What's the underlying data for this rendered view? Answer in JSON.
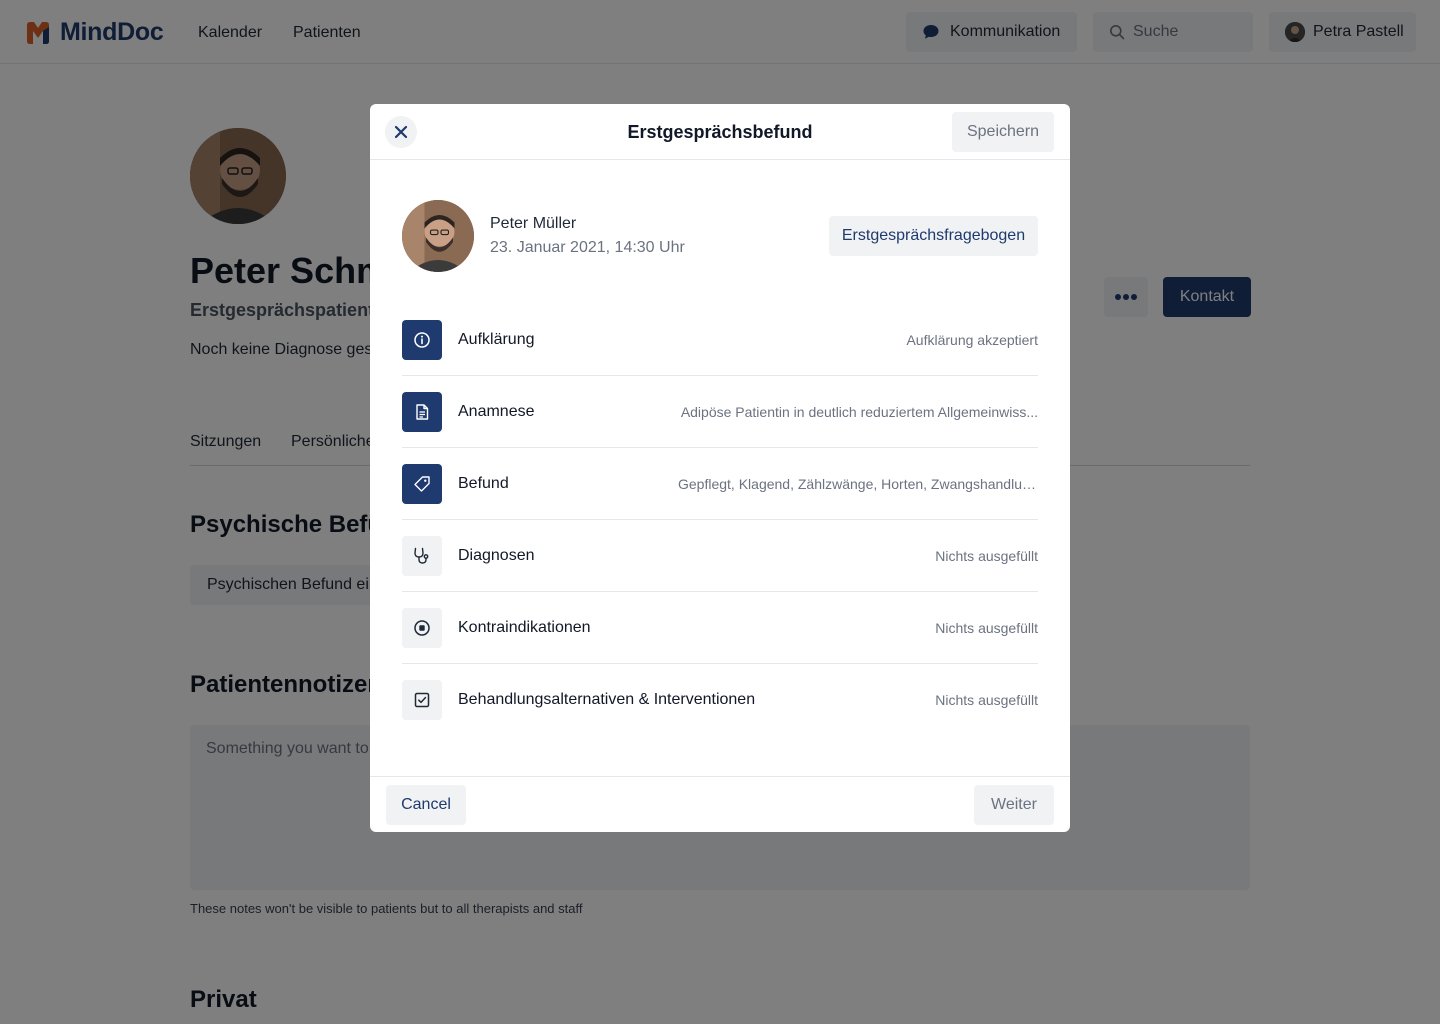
{
  "topbar": {
    "brand": "MindDoc",
    "nav": [
      "Kalender",
      "Patienten"
    ],
    "communication_label": "Kommunikation",
    "search_placeholder": "Suche",
    "user_name": "Petra Pastell"
  },
  "profile": {
    "name": "Peter Schm",
    "subtitle": "Erstgesprächspatient",
    "diagnosis": "Noch keine Diagnose gest",
    "contact_label": "Kontakt",
    "more_label": "•••"
  },
  "tabs": [
    "Sitzungen",
    "Persönliche"
  ],
  "sections": {
    "psych_title": "Psychische Befur",
    "psych_button": "Psychischen Befund ein",
    "notes_title": "Patientennotizer",
    "notes_placeholder": "Something you want to",
    "notes_hint": "These notes won't be visible to patients but to all therapists and staff",
    "private_title": "Privat"
  },
  "modal": {
    "title": "Erstgesprächsbefund",
    "save_label": "Speichern",
    "patient_name": "Peter Müller",
    "patient_date": "23. Januar 2021, 14:30 Uhr",
    "questionnaire_label": "Erstgesprächsfragebogen",
    "cancel_label": "Cancel",
    "next_label": "Weiter",
    "items": [
      {
        "label": "Aufklärung",
        "value": "Aufklärung akzeptiert",
        "icon": "info-icon",
        "filled": true
      },
      {
        "label": "Anamnese",
        "value": "Adipöse Patientin in deutlich reduziertem Allgemeinwiss...",
        "icon": "document-icon",
        "filled": true
      },
      {
        "label": "Befund",
        "value": "Gepflegt, Klagend, Zählzwänge, Horten, Zwangshandlug...",
        "icon": "tag-icon",
        "filled": true
      },
      {
        "label": "Diagnosen",
        "value": "Nichts ausgefüllt",
        "icon": "stethoscope-icon",
        "filled": false
      },
      {
        "label": "Kontraindikationen",
        "value": "Nichts ausgefüllt",
        "icon": "stop-circle-icon",
        "filled": false
      },
      {
        "label": "Behandlungsalternativen & Interventionen",
        "value": "Nichts ausgefüllt",
        "icon": "checkbox-icon",
        "filled": false
      }
    ]
  },
  "colors": {
    "brand_navy": "#1e3a6e",
    "logo_orange": "#d9622b",
    "overlay": "rgba(0,0,0,0.5)"
  }
}
